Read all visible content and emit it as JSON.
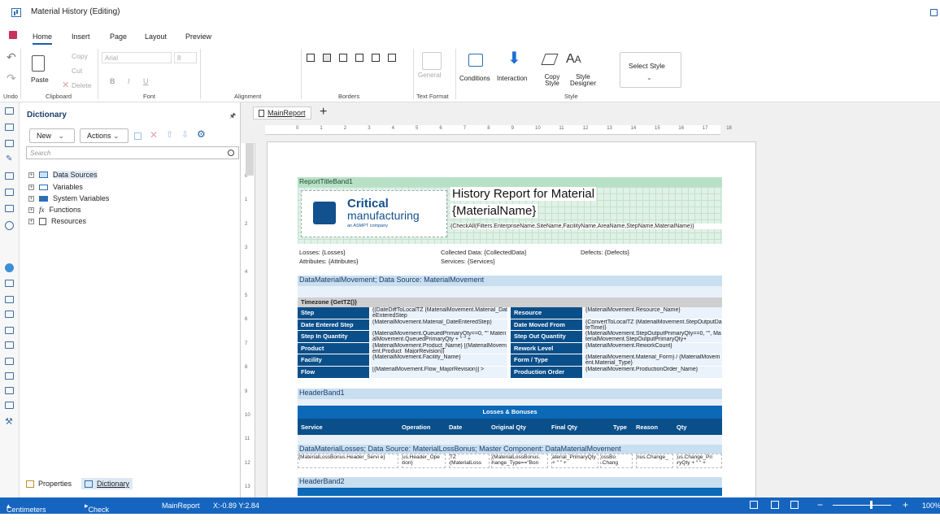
{
  "window": {
    "title": "Material History (Editing)"
  },
  "menu": [
    "Home",
    "Insert",
    "Page",
    "Layout",
    "Preview"
  ],
  "ribbon": {
    "clipboard": {
      "copy": "Copy",
      "cut": "Cut",
      "paste": "Paste",
      "delete": "Delete",
      "label": "Clipboard"
    },
    "undo_label": "Undo",
    "font": {
      "family": "Arial",
      "size": "8",
      "bold": "B",
      "italic": "I",
      "underline": "U",
      "label": "Font"
    },
    "alignment_label": "Alignment",
    "borders_label": "Borders",
    "text_format": {
      "general": "General",
      "label": "Text Format"
    },
    "style": {
      "conditions": "Conditions",
      "interaction": "Interaction",
      "copy_style": "Copy Style",
      "style_designer": "Style Designer",
      "select_style": "Select Style",
      "label": "Style"
    }
  },
  "dictionary": {
    "title": "Dictionary",
    "new": "New",
    "actions": "Actions",
    "search_placeholder": "Search",
    "items": [
      "Data Sources",
      "Variables",
      "System Variables",
      "Functions",
      "Resources"
    ],
    "tabs": {
      "properties": "Properties",
      "dictionary": "Dictionary"
    }
  },
  "report": {
    "tab": "MainReport",
    "ruler_h": [
      "0",
      "1",
      "2",
      "3",
      "4",
      "5",
      "6",
      "7",
      "8",
      "9",
      "10",
      "11",
      "12",
      "13",
      "14",
      "15",
      "16",
      "17",
      "18"
    ],
    "ruler_v": [
      "0",
      "1",
      "2",
      "3",
      "4",
      "5",
      "6",
      "7",
      "8",
      "9",
      "10",
      "11",
      "12",
      "13"
    ],
    "title_band": "ReportTitleBand1",
    "logo": {
      "line1": "Critical",
      "line2": "manufacturing",
      "line3": "an ASMPT company"
    },
    "heading1": "History Report for Material",
    "heading2": "{MaterialName}",
    "filters": "{CheckAll(Filters.EnterpriseName,SiteName,FacilityName,AreaName,StepName,MaterialName)}",
    "losses": "Losses: {Losses}",
    "attributes": "Attributes: {Attributes}",
    "collected": "Collected Data: {CollectedData}",
    "services": "Services: {Services}",
    "defects": "Defects: {Defects}",
    "movement_band": "DataMaterialMovement; Data Source: MaterialMovement",
    "timezone": "Timezone {GetTZ()}",
    "left_labels": [
      "Step",
      "Date Entered Step",
      "Step In Quantity",
      "Product",
      "Facility",
      "Flow"
    ],
    "left_values": [
      "{(DateDiffToLocalTZ (MaterialMovement.Material_DateEnteredStep",
      "(MaterialMovement.Material_DateEnteredStep)",
      "(MaterialMovement.QueuedPrimaryQty==0, \"\" MaterialMovement.QueuedPrimaryQty + \" \" +",
      "{MaterialMovement.Product_Name} [(MaterialMovement.Product_MajorRevision)]",
      "{MaterialMovement.Facility_Name}",
      "[{MaterialMovement.Flow_MajorRevision}] >"
    ],
    "right_labels": [
      "Resource",
      "Date Moved From",
      "Step Out Quantity",
      "Rework Level",
      "Form / Type",
      "Production Order"
    ],
    "right_values": [
      "{MaterialMovement.Resource_Name}",
      "{ConvertToLocalTZ (MaterialMovement.StepOutputDateTime)}",
      "(MaterialMovement.StepOutputPrimaryQty==0, \"\", MaterialMovement.StepOutputPrimaryQty+",
      "{MaterialMovement.ReworkCount}",
      "{MaterialMovement.Material_Form} / {MaterialMovement.Material_Type}",
      "{MaterialMovement.ProductionOrder_Name}"
    ],
    "header_band1": "HeaderBand1",
    "losses_title": "Losses & Bonuses",
    "losses_cols": [
      "Service",
      "Operation",
      "Date",
      "Original Qty",
      "Final Qty",
      "Type",
      "Reason",
      "Qty"
    ],
    "losses_band": "DataMaterialLosses; Data Source: MaterialLossBonus; Master Component: DataMaterialMovement",
    "losses_values": [
      "{MaterialLossBonus.Header_Servi e}",
      "us.Header_Ope tion}",
      "TZ (MaterialLoss",
      "(MaterialLossBonus. hange_Type==\"Bon",
      "aterial_PrimaryQty + \" \" +",
      "ossBo .Chang",
      "nus.Change_",
      "us.Change_Pri ryQty + \" \" +"
    ],
    "header_band2": "HeaderBand2"
  },
  "status": {
    "units": "Centimeters",
    "check": "Check for Issues",
    "report": "MainReport",
    "coords": "X:-0.89 Y:2.84",
    "zoom": "100%"
  }
}
